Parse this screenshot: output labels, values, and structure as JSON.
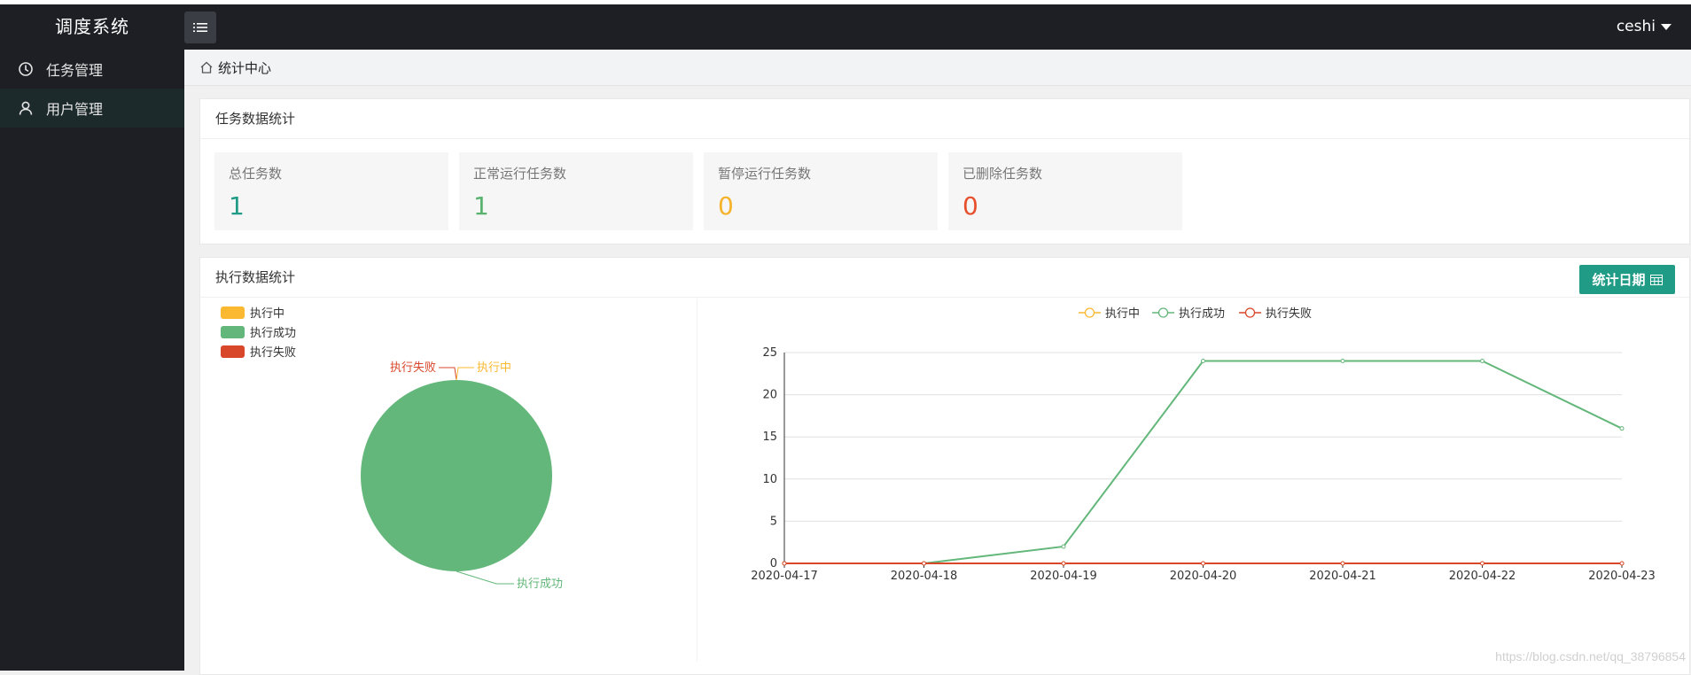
{
  "app": {
    "title": "调度系统",
    "user": "ceshi"
  },
  "sidebar": {
    "items": [
      {
        "label": "任务管理",
        "icon": "clock-icon",
        "active": false
      },
      {
        "label": "用户管理",
        "icon": "user-icon",
        "active": true
      }
    ]
  },
  "breadcrumb": {
    "current": "统计中心"
  },
  "task_stats": {
    "title": "任务数据统计",
    "cards": [
      {
        "label": "总任务数",
        "value": "1",
        "color": "#1f9b86"
      },
      {
        "label": "正常运行任务数",
        "value": "1",
        "color": "#5ab26f"
      },
      {
        "label": "暂停运行任务数",
        "value": "0",
        "color": "#f5b22b"
      },
      {
        "label": "已删除任务数",
        "value": "0",
        "color": "#e7502d"
      }
    ]
  },
  "exec_stats": {
    "title": "执行数据统计",
    "date_button": "统计日期",
    "date_button_icon": "calendar-icon"
  },
  "colors": {
    "running": "#fbb932",
    "success": "#64b77a",
    "failed": "#d9472a",
    "accent": "#1f9b86"
  },
  "chart_data": [
    {
      "type": "pie",
      "labels": [
        "执行中",
        "执行成功",
        "执行失败"
      ],
      "values": [
        0,
        100,
        0
      ],
      "legend": "top-left"
    },
    {
      "type": "line",
      "categories": [
        "2020-04-17",
        "2020-04-18",
        "2020-04-19",
        "2020-04-20",
        "2020-04-21",
        "2020-04-22",
        "2020-04-23"
      ],
      "series": [
        {
          "name": "执行中",
          "values": [
            0,
            0,
            0,
            0,
            0,
            0,
            0
          ]
        },
        {
          "name": "执行成功",
          "values": [
            0,
            0,
            2,
            24,
            24,
            24,
            16
          ]
        },
        {
          "name": "执行失败",
          "values": [
            0,
            0,
            0,
            0,
            0,
            0,
            0
          ]
        }
      ],
      "yticks": [
        "0",
        "5",
        "10",
        "15",
        "20",
        "25"
      ],
      "ylim": [
        0,
        25
      ],
      "grid": true,
      "legend": "top-center"
    }
  ],
  "watermark": "https://blog.csdn.net/qq_38796854"
}
